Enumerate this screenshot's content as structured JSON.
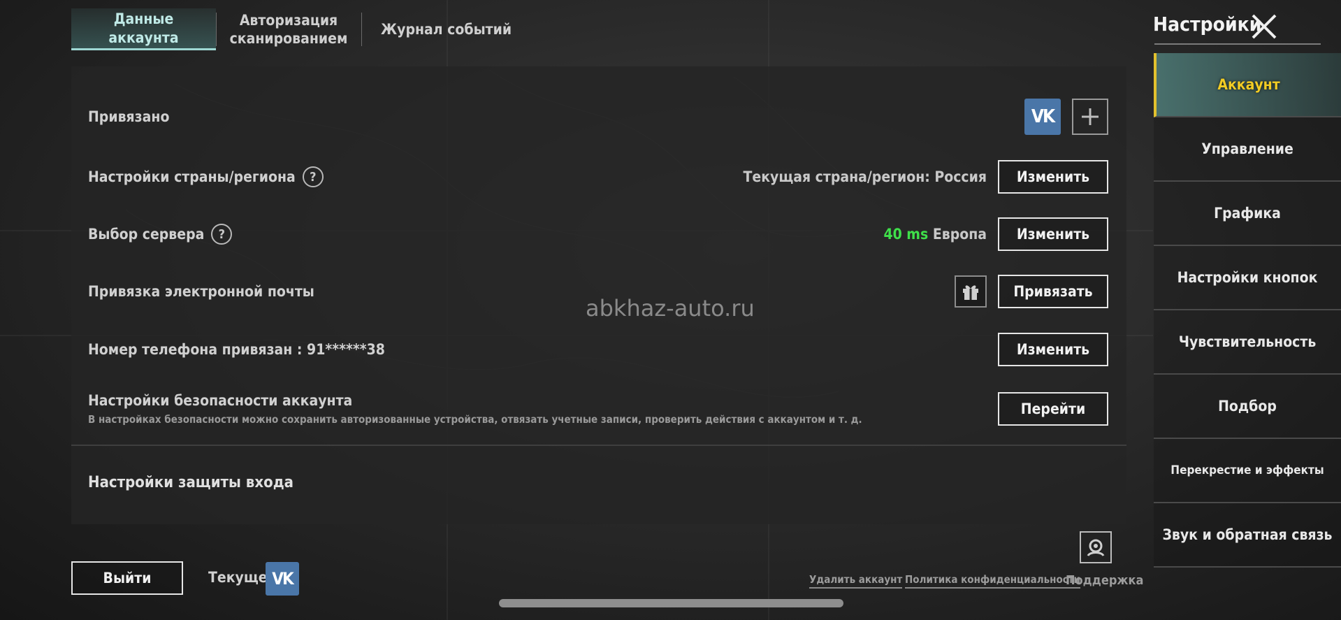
{
  "tabs": [
    {
      "label": "Данные аккаунта",
      "active": true
    },
    {
      "label": "Авторизация\nсканированием",
      "active": false
    },
    {
      "label": "Журнал событий",
      "active": false
    }
  ],
  "rows": {
    "linked": {
      "label": "Привязано"
    },
    "region": {
      "label": "Настройки страны/региона",
      "value": "Текущая страна/регион: Россия",
      "button": "Изменить"
    },
    "server": {
      "label": "Выбор сервера",
      "ping": "40 ms",
      "region": "Европа",
      "button": "Изменить"
    },
    "email": {
      "label": "Привязка электронной почты",
      "button": "Привязать"
    },
    "phone": {
      "label": "Номер телефона привязан : 91******38",
      "button": "Изменить"
    },
    "security": {
      "label": "Настройки безопасности аккаунта",
      "description": "В настройках безопасности можно сохранить авторизованные устройства, отвязать учетные записи, проверить действия с аккаунтом и т. д.",
      "button": "Перейти"
    }
  },
  "login_protection": {
    "title": "Настройки защиты входа"
  },
  "watermark": "abkhaz-auto.ru",
  "settings_title": "Настройки",
  "sidebar": [
    {
      "label": "Аккаунт",
      "active": true
    },
    {
      "label": "Управление"
    },
    {
      "label": "Графика"
    },
    {
      "label": "Настройки кнопок"
    },
    {
      "label": "Чувствительность"
    },
    {
      "label": "Подбор"
    },
    {
      "label": "Перекрестие и эффекты"
    },
    {
      "label": "Звук и обратная связь"
    }
  ],
  "bottom": {
    "logout": "Выйти",
    "current": "Текущее",
    "vk_glyph": "VK",
    "delete_account": "Удалить аккаунт",
    "privacy_policy": "Политика конфиденциальности",
    "support": "Поддержка"
  },
  "colors": {
    "accent": "#9fd8d4",
    "active_sidebar": "#f2cc24",
    "ping": "#3fe04a",
    "vk": "#4a76a8"
  },
  "icons": [
    "vk-icon",
    "plus-icon",
    "question-icon",
    "gift-icon",
    "close-icon",
    "support-icon"
  ]
}
